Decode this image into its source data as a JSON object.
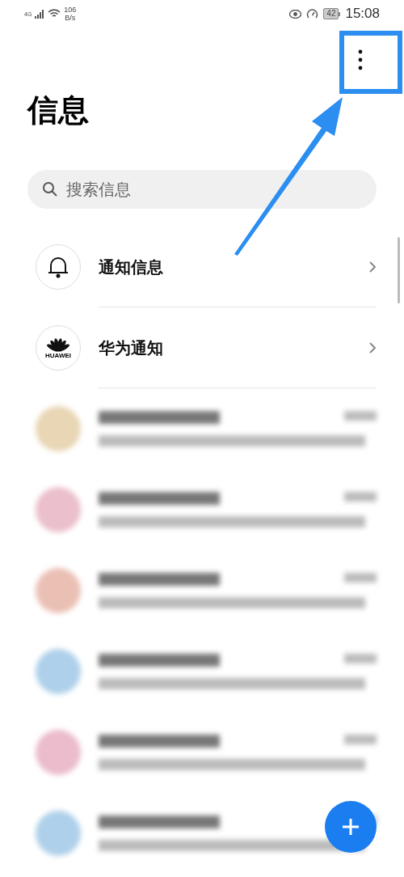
{
  "status_bar": {
    "network": "4G",
    "speed_value": "106",
    "speed_unit": "B/s",
    "battery": "42",
    "time": "15:08"
  },
  "title": "信息",
  "search": {
    "placeholder": "搜索信息"
  },
  "entries": [
    {
      "kind": "bell",
      "label": "通知信息"
    },
    {
      "kind": "logo",
      "label": "华为通知",
      "logo_text": "HUAWEI"
    }
  ],
  "conversations": [
    {
      "color": "#e8d6b4"
    },
    {
      "color": "#ebbfcb"
    },
    {
      "color": "#ebc0b4"
    },
    {
      "color": "#aed0ea"
    },
    {
      "color": "#ebbccb"
    },
    {
      "color": "#aed0ea"
    }
  ]
}
